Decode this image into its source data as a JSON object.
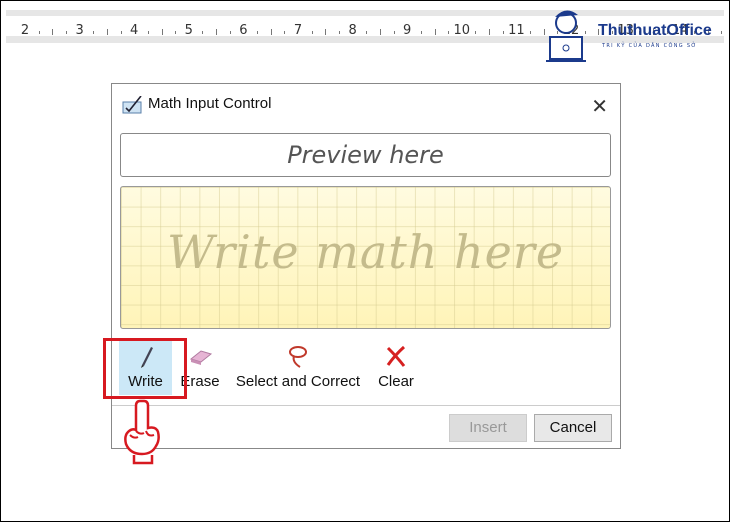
{
  "ruler": {
    "labels": [
      "2",
      "3",
      "4",
      "5",
      "6",
      "7",
      "8",
      "9",
      "10",
      "11",
      "12",
      "13",
      "14"
    ]
  },
  "logo": {
    "name": "ThuthuatOffice",
    "tagline": "TRI KỶ CỦA DÂN CÔNG SỞ"
  },
  "dialog": {
    "title": "Math Input Control",
    "close_icon": "close-icon",
    "preview_placeholder": "Preview here",
    "write_placeholder": "Write math here",
    "tools": [
      {
        "label": "Write",
        "icon": "pen-icon",
        "active": true
      },
      {
        "label": "Erase",
        "icon": "eraser-icon"
      },
      {
        "label": "Select and Correct",
        "icon": "lasso-icon"
      },
      {
        "label": "Clear",
        "icon": "clear-x-icon"
      }
    ],
    "insert_label": "Insert",
    "insert_disabled": true,
    "cancel_label": "Cancel"
  },
  "colors": {
    "highlight": "#d71920",
    "active_tool": "#cce8f7"
  }
}
